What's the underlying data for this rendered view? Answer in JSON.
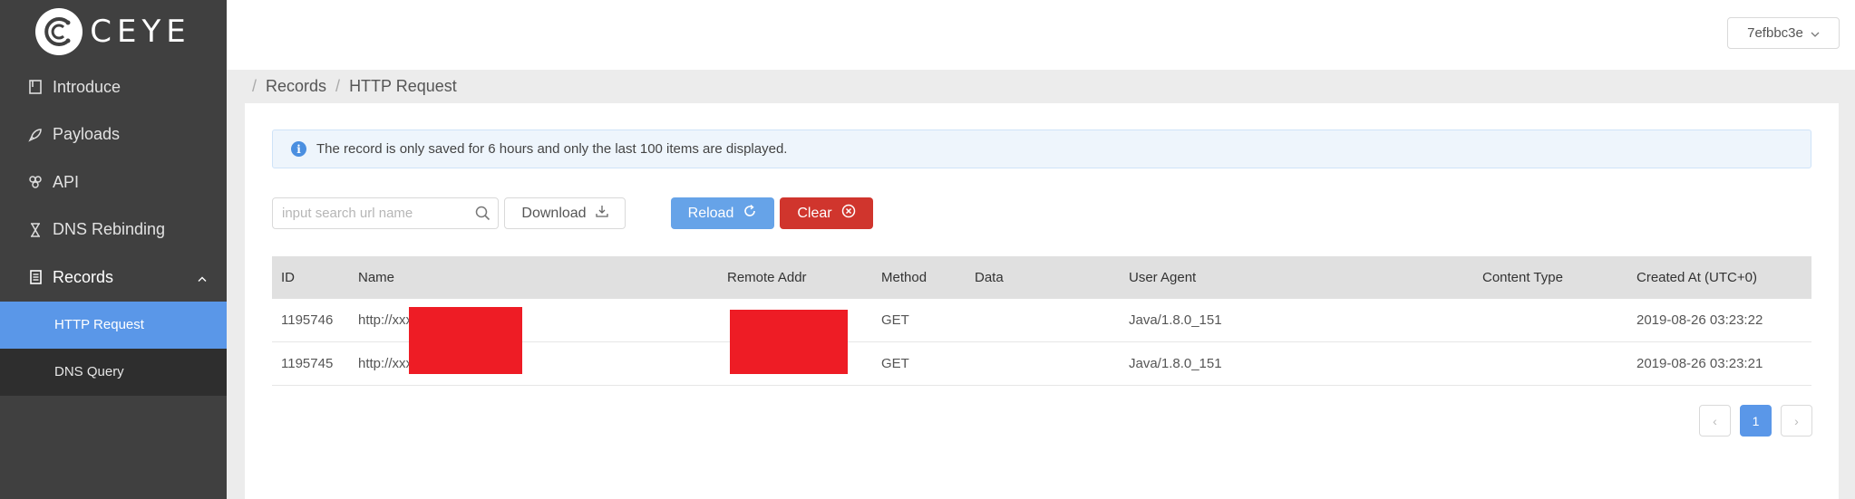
{
  "brand": {
    "name": "CEYE"
  },
  "sidebar": {
    "items": [
      {
        "label": "Introduce",
        "icon": "book-icon"
      },
      {
        "label": "Payloads",
        "icon": "rocket-icon"
      },
      {
        "label": "API",
        "icon": "api-icon"
      },
      {
        "label": "DNS Rebinding",
        "icon": "hourglass-icon"
      },
      {
        "label": "Records",
        "icon": "records-icon",
        "expanded": true
      }
    ],
    "subitems": [
      {
        "label": "HTTP Request",
        "active": true
      },
      {
        "label": "DNS Query",
        "active": false
      }
    ]
  },
  "header": {
    "user": "7efbbc3e"
  },
  "breadcrumb": {
    "items": [
      "Records",
      "HTTP Request"
    ]
  },
  "alert": {
    "text": "The record is only saved for 6 hours and only the last 100 items are displayed."
  },
  "toolbar": {
    "search_placeholder": "input search url name",
    "download_label": "Download",
    "reload_label": "Reload",
    "clear_label": "Clear"
  },
  "table": {
    "columns": [
      "ID",
      "Name",
      "Remote Addr",
      "Method",
      "Data",
      "User Agent",
      "Content Type",
      "Created At (UTC+0)"
    ],
    "rows": [
      {
        "id": "1195746",
        "name": "http://xxx",
        "remote_addr": "",
        "method": "GET",
        "data": "",
        "user_agent": "Java/1.8.0_151",
        "content_type": "",
        "created_at": "2019-08-26 03:23:22"
      },
      {
        "id": "1195745",
        "name": "http://xxx",
        "remote_addr": "",
        "method": "GET",
        "data": "",
        "user_agent": "Java/1.8.0_151",
        "content_type": "",
        "created_at": "2019-08-26 03:23:21"
      }
    ]
  },
  "pagination": {
    "prev": "‹",
    "current": "1",
    "next": "›"
  },
  "colors": {
    "sidebar_bg": "#404040",
    "active": "#5a97e8",
    "reload": "#66a3e8",
    "clear": "#d0352d",
    "redaction": "#ee1c25"
  }
}
